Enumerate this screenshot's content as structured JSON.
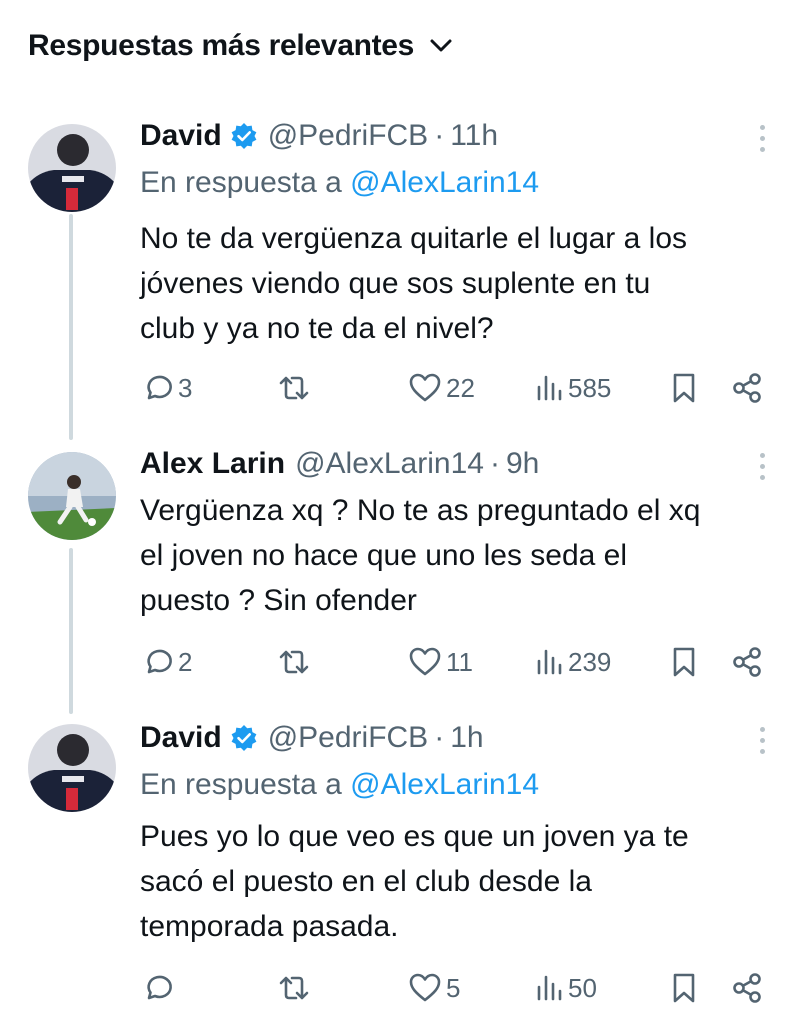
{
  "header": {
    "title": "Respuestas más relevantes",
    "chevron_icon": "chevron-down-icon"
  },
  "tweets": [
    {
      "name": "David",
      "verified": true,
      "handle": "@PedriFCB",
      "dot": "·",
      "time": "11h",
      "reply_prefix": "En respuesta a",
      "reply_mention": "@AlexLarin14",
      "lines": [
        "No te da vergüenza quitarle el lugar a los",
        "jóvenes viendo que sos suplente en tu",
        "club y ya no te da el nivel?"
      ],
      "replies": "3",
      "retweets": "",
      "likes": "22",
      "views": "585"
    },
    {
      "name": "Alex Larin",
      "verified": false,
      "handle": "@AlexLarin14",
      "dot": "·",
      "time": "9h",
      "lines": [
        "Vergüenza xq ? No te as preguntado  el xq",
        "el joven no hace  que uno les seda el",
        "puesto ? Sin ofender"
      ],
      "replies": "2",
      "retweets": "",
      "likes": "11",
      "views": "239"
    },
    {
      "name": "David",
      "verified": true,
      "handle": "@PedriFCB",
      "dot": "·",
      "time": "1h",
      "reply_prefix": "En respuesta a",
      "reply_mention": "@AlexLarin14",
      "lines": [
        "Pues yo lo que veo es que un joven ya te",
        "sacó el puesto en el club desde la",
        "temporada pasada."
      ],
      "replies": "",
      "retweets": "",
      "likes": "5",
      "views": "50"
    }
  ],
  "colors": {
    "text": "#0f1419",
    "secondary": "#536471",
    "accent": "#1d9bf0",
    "thread_line": "#cfd9de"
  }
}
